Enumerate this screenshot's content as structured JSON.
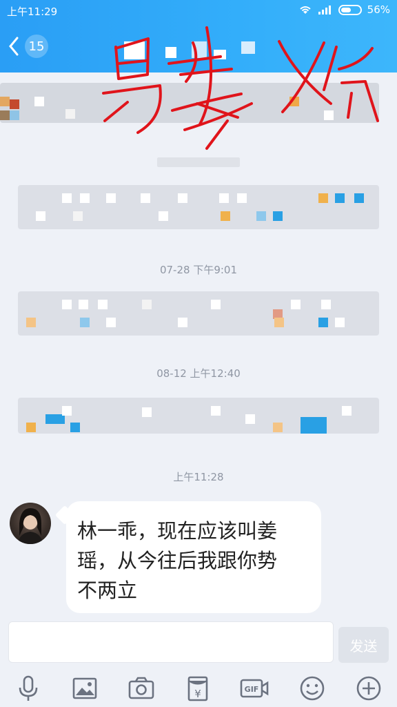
{
  "statusbar": {
    "time": "上午11:29",
    "battery": "56%",
    "battery_level": 0.56
  },
  "header": {
    "unread_count": "15"
  },
  "timestamps": [
    "07-28 下午9:01",
    "08-12 上午12:40",
    "上午11:28"
  ],
  "message": {
    "lines": [
      "林一乖，现在应该叫姜",
      "瑶，从今往后我跟你势",
      "不两立"
    ]
  },
  "composer": {
    "input_value": "",
    "send_label": "发送"
  },
  "toolbar": {
    "icons": [
      "mic-icon",
      "image-icon",
      "camera-icon",
      "red-packet-icon",
      "gif-icon",
      "emoji-icon",
      "plus-icon"
    ],
    "gif_label": "GIF",
    "yen": "¥"
  },
  "colors": {
    "header": "#2a9ef5",
    "scribble": "#e0141b",
    "bubble": "#ffffff",
    "background": "#eef1f7"
  }
}
